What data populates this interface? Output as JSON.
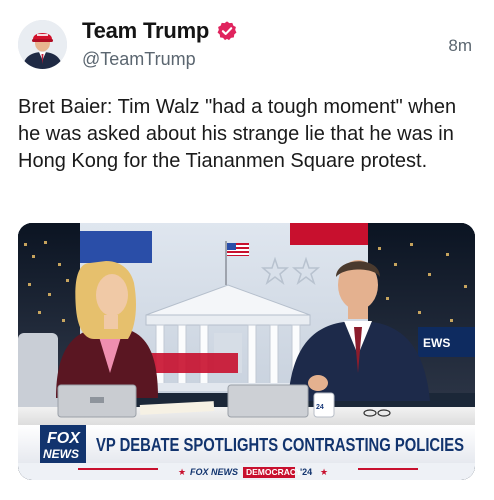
{
  "post": {
    "author_name": "Team Trump",
    "handle": "@TeamTrump",
    "time": "8m",
    "text": "Bret Baier: Tim Walz \"had a tough moment\" when he was asked about his strange lie that he was in Hong Kong for the Tiananmen Square protest."
  },
  "video": {
    "channel_logo_top": "FOX",
    "channel_logo_bottom": "NEWS",
    "headline": "VP DEBATE SPOTLIGHTS CONTRASTING POLICIES",
    "ticker_brand": "FOX NEWS",
    "ticker_tag": "DEMOCRACY",
    "ticker_year": "'24",
    "side_screen_text": "EWS",
    "mug_text": "24"
  },
  "colors": {
    "verified": "#e0245e",
    "lower_third_blue": "#12346e",
    "ticker_red": "#c8102e"
  }
}
